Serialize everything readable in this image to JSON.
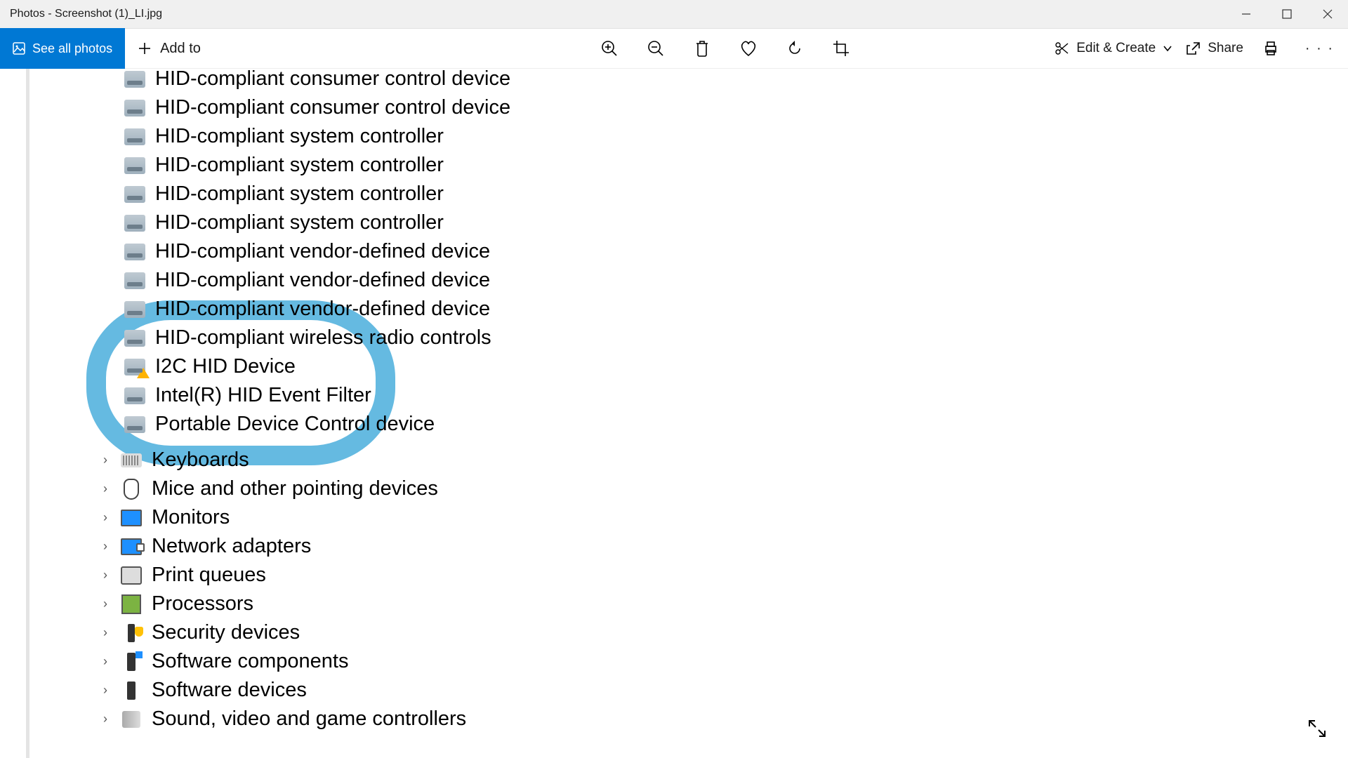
{
  "window": {
    "title": "Photos - Screenshot (1)_LI.jpg"
  },
  "toolbar": {
    "see_all": "See all photos",
    "add_to": "Add to",
    "edit_create": "Edit & Create",
    "share": "Share"
  },
  "image": {
    "hid_items": [
      "HID-compliant consumer control device",
      "HID-compliant consumer control device",
      "HID-compliant system controller",
      "HID-compliant system controller",
      "HID-compliant system controller",
      "HID-compliant system controller",
      "HID-compliant vendor-defined device",
      "HID-compliant vendor-defined device",
      "HID-compliant vendor-defined device",
      "HID-compliant wireless radio controls",
      "I2C HID Device",
      "Intel(R) HID Event Filter",
      "Portable Device Control device"
    ],
    "warn_index": 10,
    "categories": [
      "Keyboards",
      "Mice and other pointing devices",
      "Monitors",
      "Network adapters",
      "Print queues",
      "Processors",
      "Security devices",
      "Software components",
      "Software devices",
      "Sound, video and game controllers"
    ],
    "annotation_color": "#58b4de"
  }
}
